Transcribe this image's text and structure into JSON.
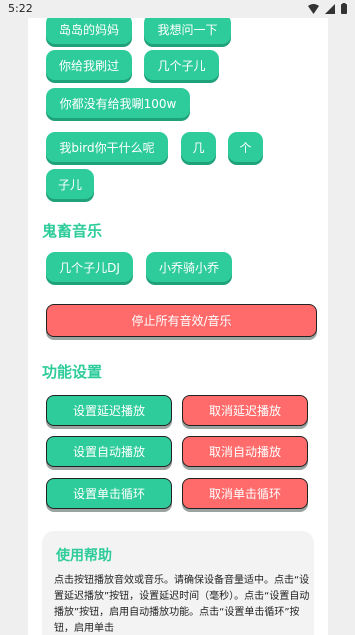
{
  "status_bar": {
    "time": "5:22"
  },
  "sound_buttons": [
    "岛岛的妈妈",
    "我想问一下",
    "你给我刷过",
    "几个子儿",
    "你都没有给我唰100w",
    "我bird你干什么呢",
    "几",
    "个",
    "子儿"
  ],
  "ghost_section": {
    "title": "鬼畜音乐",
    "buttons": [
      "几个子儿DJ",
      "小乔骑小乔"
    ]
  },
  "stop_all": "停止所有音效/音乐",
  "function_section": {
    "title": "功能设置",
    "set_delay": "设置延迟播放",
    "cancel_delay": "取消延迟播放",
    "set_auto": "设置自动播放",
    "cancel_auto": "取消自动播放",
    "set_loop": "设置单击循环",
    "cancel_loop": "取消单击循环"
  },
  "help": {
    "title": "使用帮助",
    "text": "点击按钮播放音效或音乐。请确保设备音量适中。点击“设置延迟播放”按钮，设置延迟时间（毫秒）。点击“设置自动播放”按钮，启用自动播放功能。点击“设置单击循环”按钮，启用单击"
  },
  "colors": {
    "accent": "#2ecc9a",
    "danger": "#ff6b6b"
  }
}
